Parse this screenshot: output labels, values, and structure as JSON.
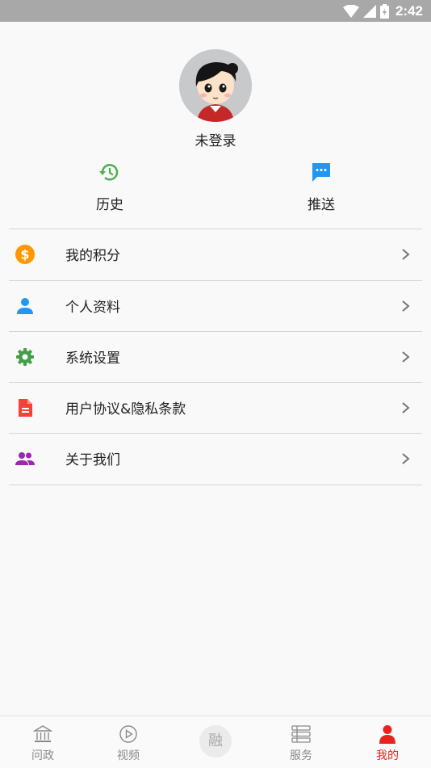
{
  "status_bar": {
    "time": "2:42",
    "icons": [
      "wifi-icon",
      "signal-icon",
      "battery-icon"
    ]
  },
  "profile": {
    "login_status": "未登录",
    "avatar_icon": "cartoon-avatar"
  },
  "quick_actions": [
    {
      "label": "历史",
      "icon": "history-icon",
      "color": "#4caf50"
    },
    {
      "label": "推送",
      "icon": "message-icon",
      "color": "#2196f3"
    }
  ],
  "menu": [
    {
      "label": "我的积分",
      "icon": "dollar-coin-icon",
      "color": "#ff9800"
    },
    {
      "label": "个人资料",
      "icon": "person-icon",
      "color": "#2196f3"
    },
    {
      "label": "系统设置",
      "icon": "gear-icon",
      "color": "#43a047"
    },
    {
      "label": "用户协议&隐私条款",
      "icon": "document-icon",
      "color": "#f44336"
    },
    {
      "label": "关于我们",
      "icon": "group-icon",
      "color": "#9c27b0"
    }
  ],
  "bottom_nav": [
    {
      "label": "问政",
      "icon": "government-building-icon"
    },
    {
      "label": "视频",
      "icon": "play-circle-icon"
    },
    {
      "label": "融",
      "icon": "rong-center-icon"
    },
    {
      "label": "服务",
      "icon": "services-list-icon"
    },
    {
      "label": "我的",
      "icon": "person-icon",
      "active": true
    }
  ],
  "colors": {
    "accent": "#e8231f",
    "statusbar": "#a8a8a8",
    "divider": "#d5d5d5"
  }
}
